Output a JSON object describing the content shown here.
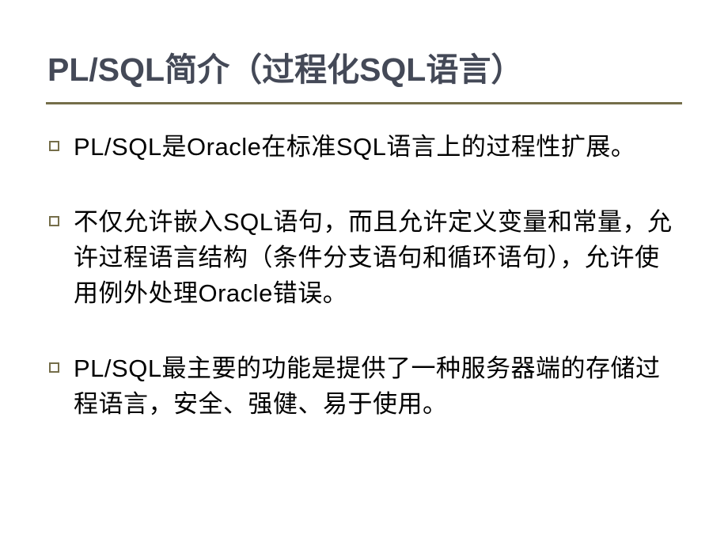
{
  "slide": {
    "title": "PL/SQL简介（过程化SQL语言）",
    "bullets": [
      "PL/SQL是Oracle在标准SQL语言上的过程性扩展。",
      "不仅允许嵌入SQL语句，而且允许定义变量和常量，允许过程语言结构（条件分支语句和循环语句），允许使用例外处理Oracle错误。",
      "PL/SQL最主要的功能是提供了一种服务器端的存储过程语言，安全、强健、易于使用。"
    ]
  }
}
